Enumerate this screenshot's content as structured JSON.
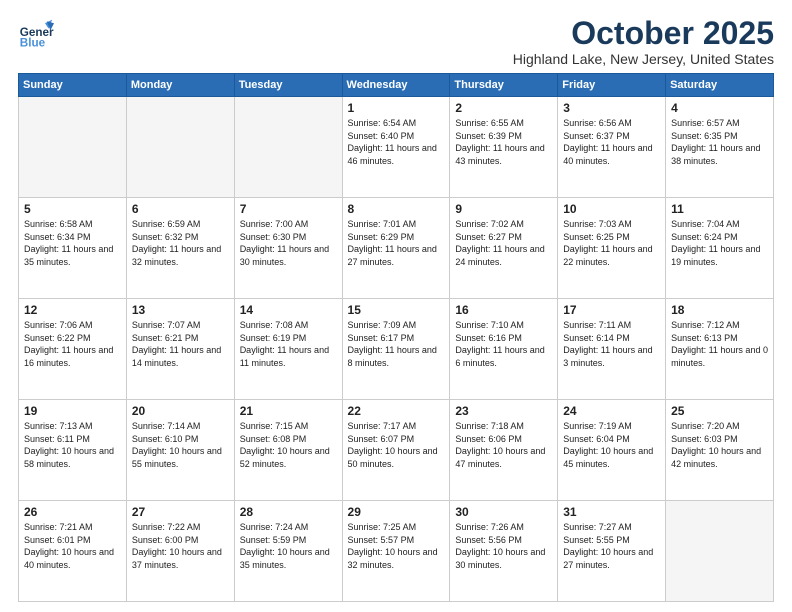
{
  "header": {
    "logo_general": "General",
    "logo_blue": "Blue",
    "month_title": "October 2025",
    "location": "Highland Lake, New Jersey, United States"
  },
  "days_of_week": [
    "Sunday",
    "Monday",
    "Tuesday",
    "Wednesday",
    "Thursday",
    "Friday",
    "Saturday"
  ],
  "weeks": [
    {
      "cells": [
        {
          "day": null,
          "content": ""
        },
        {
          "day": null,
          "content": ""
        },
        {
          "day": null,
          "content": ""
        },
        {
          "day": "1",
          "content": "Sunrise: 6:54 AM\nSunset: 6:40 PM\nDaylight: 11 hours\nand 46 minutes."
        },
        {
          "day": "2",
          "content": "Sunrise: 6:55 AM\nSunset: 6:39 PM\nDaylight: 11 hours\nand 43 minutes."
        },
        {
          "day": "3",
          "content": "Sunrise: 6:56 AM\nSunset: 6:37 PM\nDaylight: 11 hours\nand 40 minutes."
        },
        {
          "day": "4",
          "content": "Sunrise: 6:57 AM\nSunset: 6:35 PM\nDaylight: 11 hours\nand 38 minutes."
        }
      ]
    },
    {
      "cells": [
        {
          "day": "5",
          "content": "Sunrise: 6:58 AM\nSunset: 6:34 PM\nDaylight: 11 hours\nand 35 minutes."
        },
        {
          "day": "6",
          "content": "Sunrise: 6:59 AM\nSunset: 6:32 PM\nDaylight: 11 hours\nand 32 minutes."
        },
        {
          "day": "7",
          "content": "Sunrise: 7:00 AM\nSunset: 6:30 PM\nDaylight: 11 hours\nand 30 minutes."
        },
        {
          "day": "8",
          "content": "Sunrise: 7:01 AM\nSunset: 6:29 PM\nDaylight: 11 hours\nand 27 minutes."
        },
        {
          "day": "9",
          "content": "Sunrise: 7:02 AM\nSunset: 6:27 PM\nDaylight: 11 hours\nand 24 minutes."
        },
        {
          "day": "10",
          "content": "Sunrise: 7:03 AM\nSunset: 6:25 PM\nDaylight: 11 hours\nand 22 minutes."
        },
        {
          "day": "11",
          "content": "Sunrise: 7:04 AM\nSunset: 6:24 PM\nDaylight: 11 hours\nand 19 minutes."
        }
      ]
    },
    {
      "cells": [
        {
          "day": "12",
          "content": "Sunrise: 7:06 AM\nSunset: 6:22 PM\nDaylight: 11 hours\nand 16 minutes."
        },
        {
          "day": "13",
          "content": "Sunrise: 7:07 AM\nSunset: 6:21 PM\nDaylight: 11 hours\nand 14 minutes."
        },
        {
          "day": "14",
          "content": "Sunrise: 7:08 AM\nSunset: 6:19 PM\nDaylight: 11 hours\nand 11 minutes."
        },
        {
          "day": "15",
          "content": "Sunrise: 7:09 AM\nSunset: 6:17 PM\nDaylight: 11 hours\nand 8 minutes."
        },
        {
          "day": "16",
          "content": "Sunrise: 7:10 AM\nSunset: 6:16 PM\nDaylight: 11 hours\nand 6 minutes."
        },
        {
          "day": "17",
          "content": "Sunrise: 7:11 AM\nSunset: 6:14 PM\nDaylight: 11 hours\nand 3 minutes."
        },
        {
          "day": "18",
          "content": "Sunrise: 7:12 AM\nSunset: 6:13 PM\nDaylight: 11 hours\nand 0 minutes."
        }
      ]
    },
    {
      "cells": [
        {
          "day": "19",
          "content": "Sunrise: 7:13 AM\nSunset: 6:11 PM\nDaylight: 10 hours\nand 58 minutes."
        },
        {
          "day": "20",
          "content": "Sunrise: 7:14 AM\nSunset: 6:10 PM\nDaylight: 10 hours\nand 55 minutes."
        },
        {
          "day": "21",
          "content": "Sunrise: 7:15 AM\nSunset: 6:08 PM\nDaylight: 10 hours\nand 52 minutes."
        },
        {
          "day": "22",
          "content": "Sunrise: 7:17 AM\nSunset: 6:07 PM\nDaylight: 10 hours\nand 50 minutes."
        },
        {
          "day": "23",
          "content": "Sunrise: 7:18 AM\nSunset: 6:06 PM\nDaylight: 10 hours\nand 47 minutes."
        },
        {
          "day": "24",
          "content": "Sunrise: 7:19 AM\nSunset: 6:04 PM\nDaylight: 10 hours\nand 45 minutes."
        },
        {
          "day": "25",
          "content": "Sunrise: 7:20 AM\nSunset: 6:03 PM\nDaylight: 10 hours\nand 42 minutes."
        }
      ]
    },
    {
      "cells": [
        {
          "day": "26",
          "content": "Sunrise: 7:21 AM\nSunset: 6:01 PM\nDaylight: 10 hours\nand 40 minutes."
        },
        {
          "day": "27",
          "content": "Sunrise: 7:22 AM\nSunset: 6:00 PM\nDaylight: 10 hours\nand 37 minutes."
        },
        {
          "day": "28",
          "content": "Sunrise: 7:24 AM\nSunset: 5:59 PM\nDaylight: 10 hours\nand 35 minutes."
        },
        {
          "day": "29",
          "content": "Sunrise: 7:25 AM\nSunset: 5:57 PM\nDaylight: 10 hours\nand 32 minutes."
        },
        {
          "day": "30",
          "content": "Sunrise: 7:26 AM\nSunset: 5:56 PM\nDaylight: 10 hours\nand 30 minutes."
        },
        {
          "day": "31",
          "content": "Sunrise: 7:27 AM\nSunset: 5:55 PM\nDaylight: 10 hours\nand 27 minutes."
        },
        {
          "day": null,
          "content": ""
        }
      ]
    }
  ]
}
